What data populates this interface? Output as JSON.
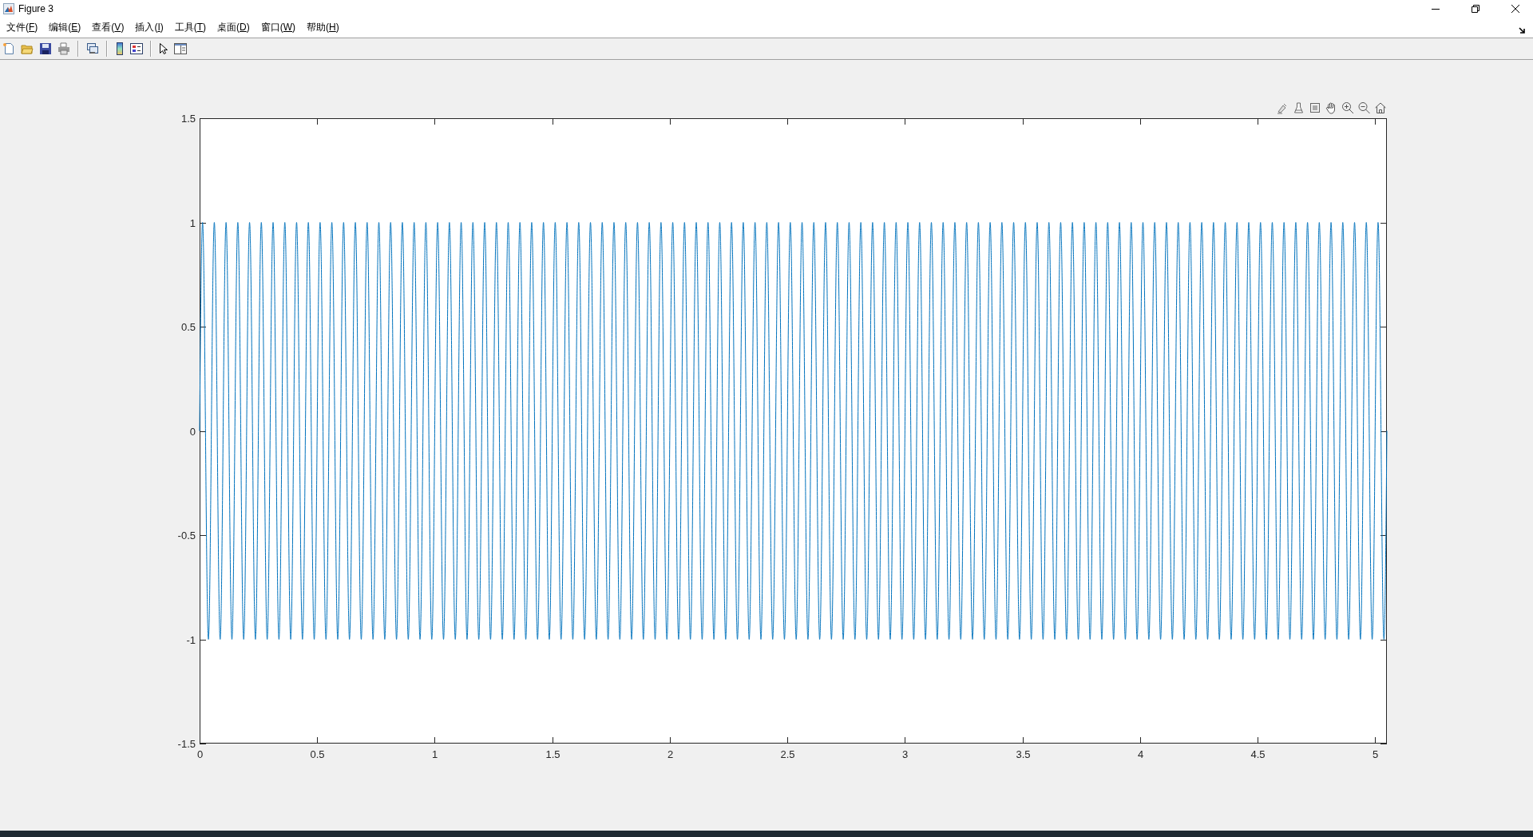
{
  "window": {
    "title": "Figure 3"
  },
  "menu": [
    "文件(F)",
    "编辑(E)",
    "查看(V)",
    "插入(I)",
    "工具(T)",
    "桌面(D)",
    "窗口(W)",
    "帮助(H)"
  ],
  "plot": {
    "x_tick_labels": [
      "0",
      "0.5",
      "1",
      "1.5",
      "2",
      "2.5",
      "3",
      "3.5",
      "4",
      "4.5",
      "5"
    ],
    "y_tick_labels": [
      "1.5",
      "1",
      "0.5",
      "0",
      "-0.5",
      "-1",
      "-1.5"
    ]
  }
}
